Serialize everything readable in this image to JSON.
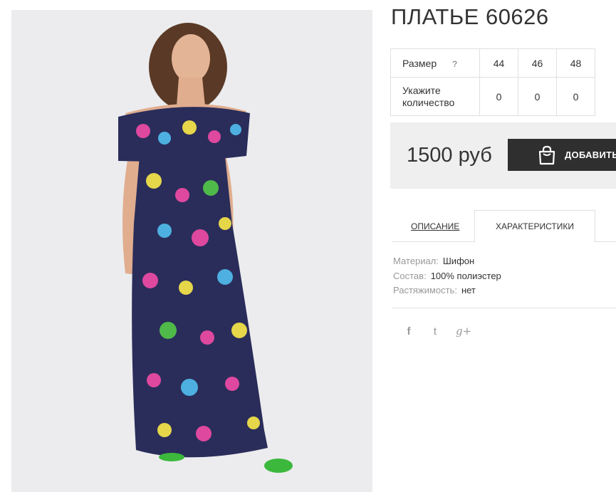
{
  "product": {
    "title": "ПЛАТЬЕ 60626"
  },
  "sizes": {
    "label": "Размер",
    "help": "?",
    "values": [
      "44",
      "46",
      "48"
    ],
    "qty_label_line1": "Укажите",
    "qty_label_line2": "количество",
    "quantities": [
      "0",
      "0",
      "0"
    ]
  },
  "price": {
    "text": "1500 руб",
    "add_label": "ДОБАВИТЬ"
  },
  "tabs": {
    "description": "ОПИСАНИЕ",
    "characteristics": "ХАРАКТЕРИСТИКИ"
  },
  "props": [
    {
      "k": "Материал:",
      "v": "Шифон"
    },
    {
      "k": "Состав:",
      "v": "100% полиэстер"
    },
    {
      "k": "Растяжимость:",
      "v": "нет"
    }
  ],
  "social": {
    "facebook": "f",
    "twitter": "t",
    "google": "g+"
  },
  "colors": {
    "button": "#2f2f2f",
    "price_bg": "#efefef",
    "photo_bg": "#ececee"
  }
}
